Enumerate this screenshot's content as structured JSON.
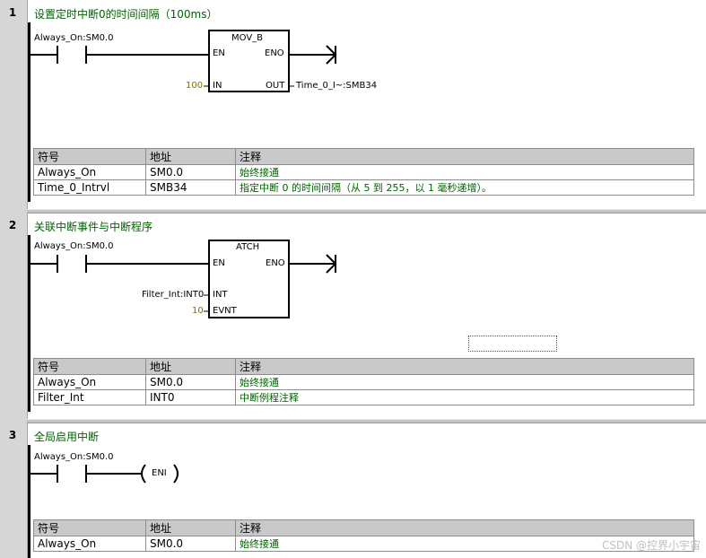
{
  "networks": [
    {
      "number": "1",
      "title": "设置定时中断0的时间间隔（100ms）",
      "contact_label": "Always_On:SM0.0",
      "box": {
        "name": "MOV_B",
        "pins": {
          "en": "EN",
          "eno": "ENO",
          "in": "IN",
          "out": "OUT"
        },
        "in_value": "100",
        "out_value": "Time_0_I~:SMB34"
      },
      "table": {
        "headers": [
          "符号",
          "地址",
          "注释"
        ],
        "rows": [
          [
            "Always_On",
            "SM0.0",
            "始终接通"
          ],
          [
            "Time_0_Intrvl",
            "SMB34",
            "指定中断 0 的时间间隔（从 5 到 255，以 1 毫秒递增）。"
          ]
        ]
      }
    },
    {
      "number": "2",
      "title": "关联中断事件与中断程序",
      "contact_label": "Always_On:SM0.0",
      "box": {
        "name": "ATCH",
        "pins": {
          "en": "EN",
          "eno": "ENO",
          "int": "INT",
          "evnt": "EVNT"
        },
        "int_value": "Filter_Int:INT0",
        "evnt_value": "10"
      },
      "table": {
        "headers": [
          "符号",
          "地址",
          "注释"
        ],
        "rows": [
          [
            "Always_On",
            "SM0.0",
            "始终接通"
          ],
          [
            "Filter_Int",
            "INT0",
            "中断例程注释"
          ]
        ]
      }
    },
    {
      "number": "3",
      "title": "全局启用中断",
      "contact_label": "Always_On:SM0.0",
      "coil": "ENI",
      "table": {
        "headers": [
          "符号",
          "地址",
          "注释"
        ],
        "rows": [
          [
            "Always_On",
            "SM0.0",
            "始终接通"
          ]
        ]
      }
    }
  ],
  "watermark": "CSDN @控界小宇宙",
  "colors": {
    "comment": "#006400",
    "constant": "#807000",
    "header_bg": "#c9c9c9",
    "gutter": "#d6d6d6"
  }
}
